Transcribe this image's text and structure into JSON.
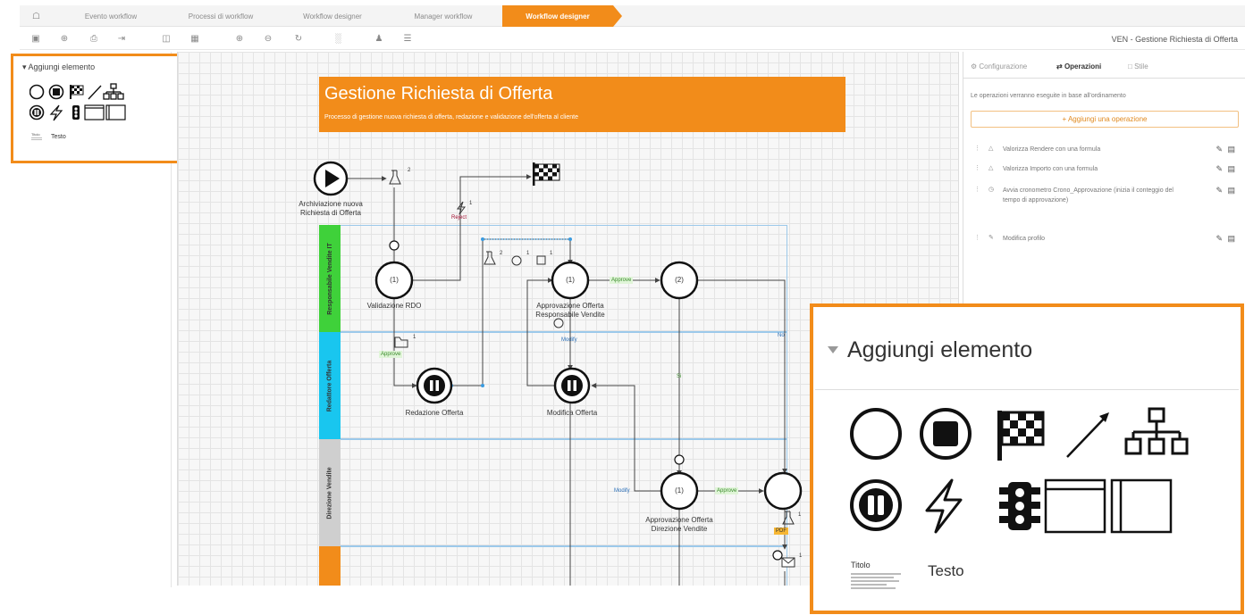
{
  "breadcrumb": {
    "items": [
      "Evento workflow",
      "Processi di workflow",
      "Workflow designer",
      "Manager workflow",
      "Workflow designer"
    ],
    "active_index": 4
  },
  "toolbar": {
    "document_title": "VEN - Gestione Richiesta di Offerta"
  },
  "left_panel": {
    "title": "Aggiungi elemento",
    "caret": "▾",
    "text_item_label": "Testo",
    "title_item_label": "Titolo"
  },
  "diagram": {
    "title": "Gestione Richiesta di Offerta",
    "subtitle": "Processo di gestione nuova richiesta di offerta, redazione e validazione dell'offerta al cliente",
    "lanes": [
      {
        "label": "Responsabile Vendite IT",
        "color": "#3fd13a"
      },
      {
        "label": "Redattore Offerta",
        "color": "#19c6ef"
      },
      {
        "label": "Direzione Vendite",
        "color": "#cfcfcf"
      },
      {
        "label": "",
        "color": "#f28c1a"
      }
    ],
    "nodes": {
      "start_label": "Archiviazione nuova Richiesta di Offerta",
      "validation_label": "Validazione RDO",
      "approval_label": "Approvazione Offerta Responsabile Vendite",
      "drafting_label": "Redazione Offerta",
      "modify_label": "Modifica Offerta",
      "director_label": "Approvazione Offerta Direzione Vendite",
      "counter_1": "(1)",
      "counter_2": "(2)"
    },
    "edges": {
      "reject": "Reject",
      "approve": "Approve",
      "modify": "Modify",
      "no": "No",
      "si": "Si",
      "pdf": "PDF"
    },
    "marks": {
      "one": "1",
      "two": "2"
    }
  },
  "right_panel": {
    "tabs": [
      "Configurazione",
      "Operazioni",
      "Stile"
    ],
    "active_tab": 1,
    "description": "Le operazioni verranno eseguite in base all'ordinamento",
    "add_button": "+ Aggiungi una operazione",
    "operations": [
      "Valorizza Rendere con una formula",
      "Valorizza Importo con una formula",
      "Avvia cronometro Crono_Approvazione (inizia il conteggio del tempo di approvazione)",
      "Modifica profilo"
    ]
  },
  "zoom": {
    "title": "Aggiungi elemento",
    "titolo_label": "Titolo",
    "testo_label": "Testo"
  },
  "colors": {
    "accent": "#f28c1a",
    "lane_border": "#9cc9ea",
    "edge": "#444444"
  }
}
